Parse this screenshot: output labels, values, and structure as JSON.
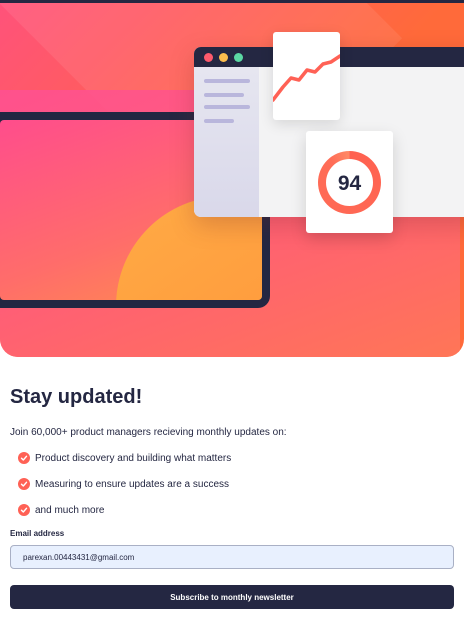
{
  "hero": {
    "score": "94",
    "colors": {
      "brand_dark": "#242742",
      "accent_orange": "#ff6a3a",
      "accent_pink": "#ff527b",
      "chart_line": "#ff6155"
    }
  },
  "signup": {
    "title": "Stay updated!",
    "intro": "Join 60,000+ product managers recieving monthly updates on:",
    "features": [
      "Product discovery and building what matters",
      "Measuring to ensure updates are a success",
      "and much more"
    ],
    "email_label": "Email address",
    "email_value": "parexan.00443431@gmail.com",
    "submit_label": "Subscribe to monthly newsletter"
  },
  "icons": {
    "feature_bullet": "check-circle-icon",
    "window_controls": [
      "red-dot",
      "yellow-dot",
      "green-dot"
    ]
  }
}
